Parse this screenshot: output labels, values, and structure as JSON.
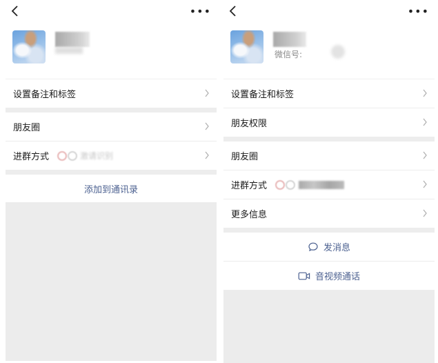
{
  "left": {
    "rows": [
      {
        "label": "设置备注和标签"
      },
      {
        "label": "朋友圈"
      },
      {
        "label": "进群方式",
        "blurred_text": "激请识别"
      }
    ],
    "action": {
      "label": "添加到通讯录"
    }
  },
  "right": {
    "wechat_id_label": "微信号:",
    "rows": [
      {
        "label": "设置备注和标签"
      },
      {
        "label": "朋友权限"
      },
      {
        "label": "朋友圈"
      },
      {
        "label": "进群方式"
      },
      {
        "label": "更多信息"
      }
    ],
    "actions": [
      {
        "label": "发消息",
        "icon": "chat-bubble-icon"
      },
      {
        "label": "音视频通话",
        "icon": "video-camera-icon"
      }
    ]
  },
  "icons": {
    "back": "chevron-left-icon",
    "more": "more-dots-icon",
    "row_arrow": "chevron-right-icon"
  },
  "colors": {
    "link": "#4a5f8f",
    "separator": "#ededed",
    "blank_area": "#ececec"
  }
}
